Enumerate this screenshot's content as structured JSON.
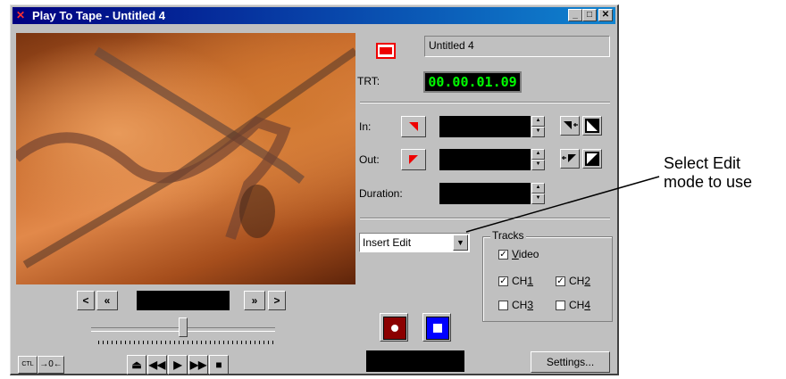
{
  "window": {
    "title": "Play To Tape - Untitled 4"
  },
  "clip": {
    "name": "Untitled 4"
  },
  "trt": {
    "label": "TRT:",
    "value": "00.00.01.09"
  },
  "edit_points": {
    "in_label": "In:",
    "out_label": "Out:",
    "duration_label": "Duration:"
  },
  "edit_mode": {
    "selected": "Insert Edit",
    "options": [
      "Insert Edit"
    ]
  },
  "tracks": {
    "title": "Tracks",
    "video": {
      "label": "Video",
      "checked": true
    },
    "ch1": {
      "label": "CH1",
      "checked": true
    },
    "ch2": {
      "label": "CH2",
      "checked": true
    },
    "ch3": {
      "label": "CH3",
      "checked": false
    },
    "ch4": {
      "label": "CH4",
      "checked": false
    }
  },
  "buttons": {
    "settings": "Settings...",
    "ctl": "CTL",
    "zero": "→0←"
  },
  "jog": {
    "prev_frame": "<",
    "rewind": "«",
    "forward": "»",
    "next_frame": ">"
  },
  "callout": {
    "line1": "Select Edit",
    "line2": "mode to use"
  },
  "colors": {
    "title_bar": "#000080",
    "timecode_green": "#00ff00",
    "record_red": "#8b0000",
    "stop_blue": "#0000ff"
  }
}
